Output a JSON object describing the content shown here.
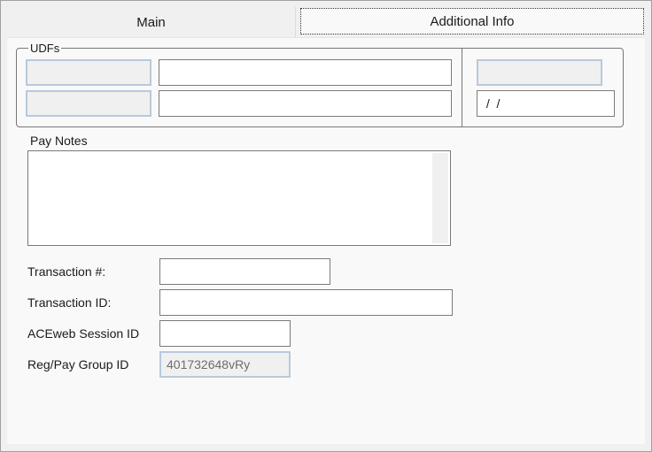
{
  "tabs": {
    "main": "Main",
    "additional": "Additional Info"
  },
  "udfs": {
    "title": "UDFs",
    "row1": {
      "code": "",
      "text": "",
      "right": ""
    },
    "row2": {
      "code": "",
      "text": "",
      "date": " /  /"
    }
  },
  "pay_notes": {
    "label": "Pay Notes",
    "value": ""
  },
  "transaction_num": {
    "label": "Transaction #:",
    "value": ""
  },
  "transaction_id": {
    "label": "Transaction ID:",
    "value": ""
  },
  "aceweb_session": {
    "label": "ACEweb Session ID",
    "value": ""
  },
  "reg_pay_group": {
    "label": "Reg/Pay Group ID",
    "value": "401732648vRy"
  }
}
